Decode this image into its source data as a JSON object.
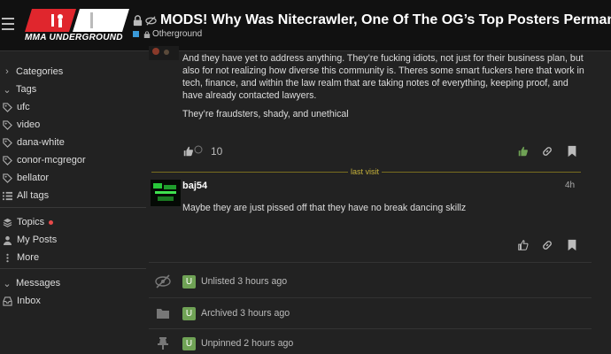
{
  "header": {
    "logo_text": "MMA UNDERGROUND",
    "topic_title": "MODS! Why Was Nitecrawler, One Of The OG’s Top Posters Permanently …",
    "category": "Otherground"
  },
  "sidebar": {
    "categories_label": "Categories",
    "tags_label": "Tags",
    "tags": [
      "ufc",
      "video",
      "dana-white",
      "conor-mcgregor",
      "bellator"
    ],
    "all_tags_label": "All tags",
    "topics_label": "Topics",
    "my_posts_label": "My Posts",
    "more_label": "More",
    "messages_label": "Messages",
    "inbox_label": "Inbox"
  },
  "post1": {
    "paragraph1": "And they have yet to address anything. They’re fucking idiots, not just for their business plan, but also for not realizing how diverse this community is. Theres some smart fuckers here that work in tech, finance, and within the law realm that are taking notes of everything, keeping proof, and have already contacted lawyers.",
    "paragraph2": "They’re fraudsters, shady, and unethical",
    "like_count": "10"
  },
  "divider": {
    "label": "last visit"
  },
  "post2": {
    "username": "baj54",
    "age": "4h",
    "body": "Maybe they are just pissed off that they have no break dancing skillz"
  },
  "small_actions": [
    {
      "icon": "eye-slash-icon",
      "avatar_letter": "U",
      "text": "Unlisted 3 hours ago"
    },
    {
      "icon": "folder-icon",
      "avatar_letter": "U",
      "text": "Archived 3 hours ago"
    },
    {
      "icon": "thumbtack-icon",
      "avatar_letter": "U",
      "text": "Unpinned 2 hours ago"
    }
  ],
  "colors": {
    "background": "#222222",
    "header": "#111111",
    "accent_red": "#e0262d",
    "liked_green": "#6fa255",
    "last_visit": "#c7b23a",
    "category": "#3a9ad9"
  }
}
